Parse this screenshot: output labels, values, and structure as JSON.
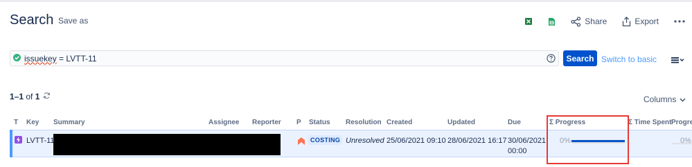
{
  "header": {
    "title": "Search",
    "save_as": "Save as"
  },
  "toolbar": {
    "share_label": "Share",
    "export_label": "Export"
  },
  "search": {
    "jql_keyword": "issuekey",
    "jql_rest": " = LVTT-11",
    "search_button": "Search",
    "switch_link": "Switch to basic"
  },
  "results": {
    "count_range": "1–1",
    "count_of": " of ",
    "count_total": "1",
    "columns_label": "Columns"
  },
  "table": {
    "headers": {
      "type": "T",
      "key": "Key",
      "summary": "Summary",
      "assignee": "Assignee",
      "reporter": "Reporter",
      "priority": "P",
      "status": "Status",
      "resolution": "Resolution",
      "created": "Created",
      "updated": "Updated",
      "due": "Due",
      "progress_sum": "Σ Progress",
      "time_spent_sum": "Σ Time Spent",
      "progress": "Progress"
    },
    "row": {
      "key": "LVTT-11",
      "status": "COSTING",
      "resolution": "Unresolved",
      "created": "25/06/2021 09:10",
      "updated": "28/06/2021 16:17",
      "due_date": "30/06/2021",
      "due_time": "00:00",
      "progress_sum_label": "0%",
      "progress_sum_value": 0,
      "progress_label": "0%",
      "progress_value": 0
    }
  },
  "colors": {
    "primary": "#0052cc",
    "link": "#4c9aff",
    "status_bg": "#deebff",
    "status_text": "#0747a6",
    "highlight": "#e53935",
    "priority": "#ff7452",
    "type_icon": "#904ee2"
  },
  "icons": {
    "excel": "excel-icon",
    "sheets": "google-sheets-icon",
    "share": "share-icon",
    "export": "export-icon",
    "more": "more-icon",
    "valid": "check-circle-icon",
    "help": "help-icon",
    "menu": "list-menu-icon",
    "refresh": "refresh-icon",
    "chevron": "chevron-down-icon",
    "type": "issue-type-icon",
    "priority": "priority-icon"
  }
}
